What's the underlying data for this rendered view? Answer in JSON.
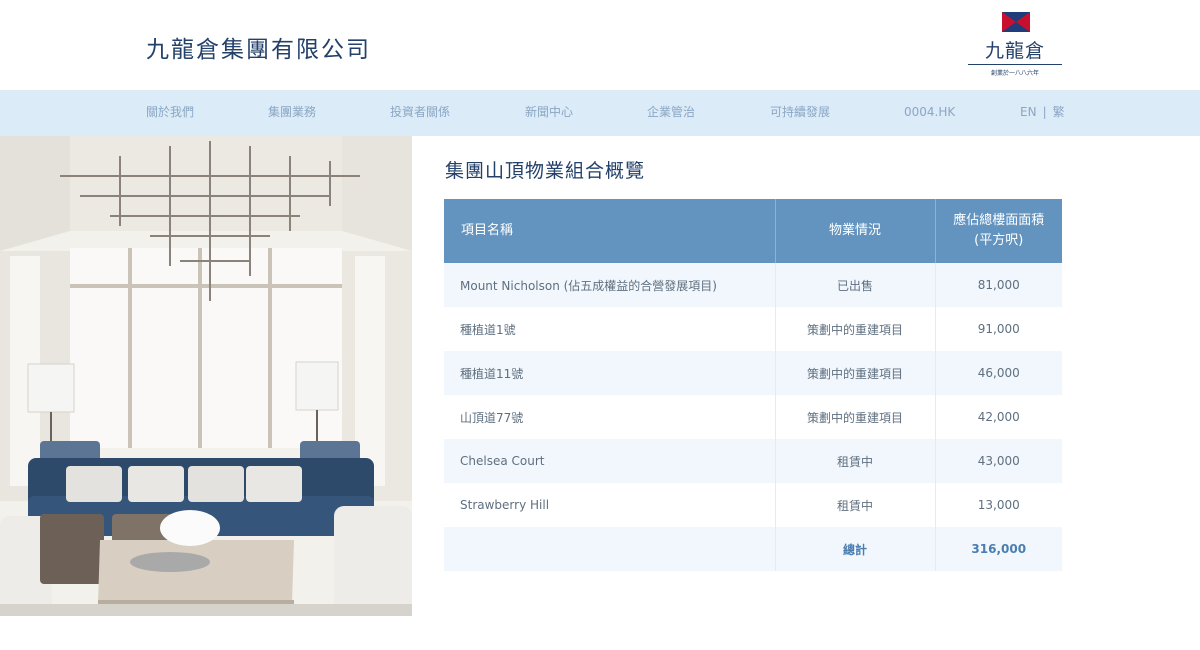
{
  "header": {
    "company_name": "九龍倉集團有限公司",
    "logo_text": "九龍倉",
    "logo_subtext": "創業於一八八六年"
  },
  "nav": {
    "items": [
      {
        "label": "關於我們"
      },
      {
        "label": "集團業務"
      },
      {
        "label": "投資者關係"
      },
      {
        "label": "新聞中心"
      },
      {
        "label": "企業管治"
      },
      {
        "label": "可持續發展"
      },
      {
        "label": "0004.HK"
      }
    ],
    "lang_en": "EN",
    "lang_sep": "|",
    "lang_tc": "繁"
  },
  "main": {
    "title": "集團山頂物業組合概覽",
    "table": {
      "headers": [
        "項目名稱",
        "物業情況",
        "應佔總樓面面積 (平方呎)"
      ],
      "rows": [
        {
          "name": "Mount Nicholson (佔五成權益的合營發展項目)",
          "status": "已出售",
          "area": "81,000"
        },
        {
          "name": "種植道1號",
          "status": "策劃中的重建項目",
          "area": "91,000"
        },
        {
          "name": "種植道11號",
          "status": "策劃中的重建項目",
          "area": "46,000"
        },
        {
          "name": "山頂道77號",
          "status": "策劃中的重建項目",
          "area": "42,000"
        },
        {
          "name": "Chelsea Court",
          "status": "租賃中",
          "area": "43,000"
        },
        {
          "name": "Strawberry Hill",
          "status": "租賃中",
          "area": "13,000"
        }
      ],
      "total_label": "總計",
      "total_value": "316,000"
    }
  },
  "colors": {
    "brand_navy": "#24416b",
    "nav_bg": "#dcebf8",
    "table_header": "#6393bf",
    "total_text": "#4a7db0",
    "logo_red": "#c8102e"
  }
}
